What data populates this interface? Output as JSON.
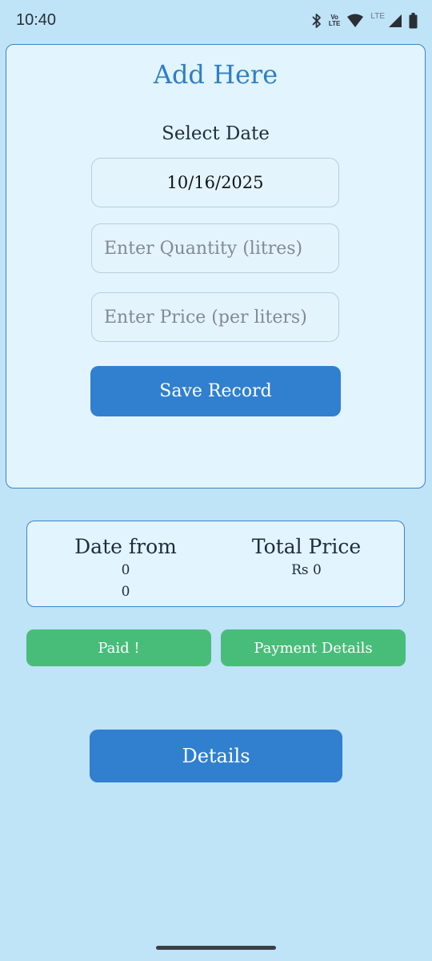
{
  "status_bar": {
    "time": "10:40",
    "volte_top": "Vo",
    "volte_bottom": "LTE",
    "lte_label": "LTE",
    "icons": [
      "bluetooth-icon",
      "volte-icon",
      "wifi-icon",
      "signal-icon",
      "battery-icon"
    ]
  },
  "add_form": {
    "title": "Add Here",
    "select_date_label": "Select Date",
    "date_value": "10/16/2025",
    "quantity_placeholder": "Enter Quantity (litres)",
    "price_placeholder": "Enter Price (per liters)",
    "save_label": "Save Record"
  },
  "summary": {
    "date_from_label": "Date from",
    "date_from_value_1": "0",
    "date_from_value_2": "0",
    "total_price_label": "Total Price",
    "total_price_value": "Rs 0"
  },
  "actions": {
    "paid_label": "Paid !",
    "payment_details_label": "Payment Details",
    "details_label": "Details"
  },
  "colors": {
    "background": "#bfe3f7",
    "card": "#e2f4fd",
    "primary": "#3180cf",
    "success": "#48bd79",
    "title": "#2f7fc4"
  }
}
